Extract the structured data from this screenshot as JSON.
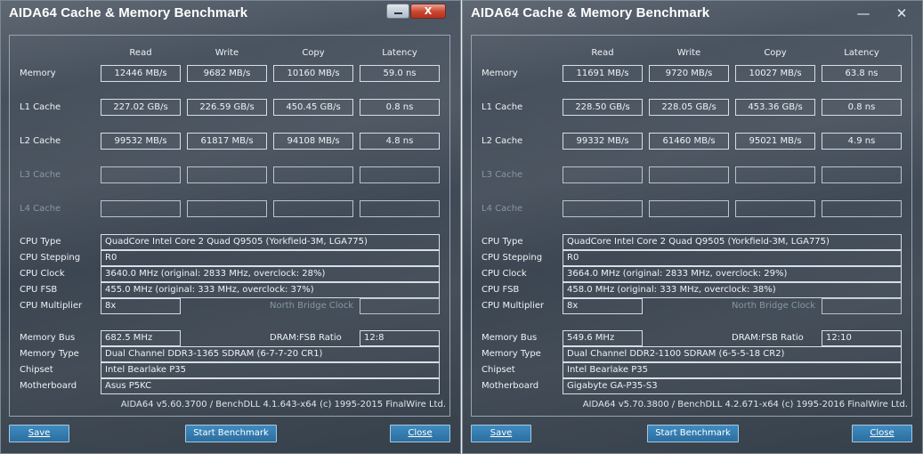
{
  "left": {
    "title": "AIDA64 Cache & Memory Benchmark",
    "close_glyph": "X",
    "headers": [
      "Read",
      "Write",
      "Copy",
      "Latency"
    ],
    "rows": {
      "memory": {
        "label": "Memory",
        "read": "12446 MB/s",
        "write": "9682 MB/s",
        "copy": "10160 MB/s",
        "latency": "59.0 ns"
      },
      "l1": {
        "label": "L1 Cache",
        "read": "227.02 GB/s",
        "write": "226.59 GB/s",
        "copy": "450.45 GB/s",
        "latency": "0.8 ns"
      },
      "l2": {
        "label": "L2 Cache",
        "read": "99532 MB/s",
        "write": "61817 MB/s",
        "copy": "94108 MB/s",
        "latency": "4.8 ns"
      },
      "l3": {
        "label": "L3 Cache"
      },
      "l4": {
        "label": "L4 Cache"
      }
    },
    "cpu_type_label": "CPU Type",
    "cpu_type": "QuadCore Intel Core 2 Quad Q9505  (Yorkfield-3M, LGA775)",
    "cpu_stepping_label": "CPU Stepping",
    "cpu_stepping": "R0",
    "cpu_clock_label": "CPU Clock",
    "cpu_clock": "3640.0 MHz  (original: 2833 MHz, overclock: 28%)",
    "cpu_fsb_label": "CPU FSB",
    "cpu_fsb": "455.0 MHz  (original: 333 MHz, overclock: 37%)",
    "cpu_multiplier_label": "CPU Multiplier",
    "cpu_multiplier": "8x",
    "nb_clock_label": "North Bridge Clock",
    "memory_bus_label": "Memory Bus",
    "memory_bus": "682.5 MHz",
    "dram_ratio_label": "DRAM:FSB Ratio",
    "dram_ratio": "12:8",
    "memory_type_label": "Memory Type",
    "memory_type": "Dual Channel DDR3-1365 SDRAM  (6-7-7-20 CR1)",
    "chipset_label": "Chipset",
    "chipset": "Intel Bearlake P35",
    "motherboard_label": "Motherboard",
    "motherboard": "Asus P5KC",
    "footer": "AIDA64 v5.60.3700 / BenchDLL 4.1.643-x64  (c) 1995-2015 FinalWire Ltd.",
    "buttons": {
      "save": "Save",
      "start": "Start Benchmark",
      "close": "Close"
    }
  },
  "right": {
    "title": "AIDA64 Cache & Memory Benchmark",
    "minimize_glyph": "—",
    "close_glyph": "✕",
    "headers": [
      "Read",
      "Write",
      "Copy",
      "Latency"
    ],
    "rows": {
      "memory": {
        "label": "Memory",
        "read": "11691 MB/s",
        "write": "9720 MB/s",
        "copy": "10027 MB/s",
        "latency": "63.8 ns"
      },
      "l1": {
        "label": "L1 Cache",
        "read": "228.50 GB/s",
        "write": "228.05 GB/s",
        "copy": "453.36 GB/s",
        "latency": "0.8 ns"
      },
      "l2": {
        "label": "L2 Cache",
        "read": "99332 MB/s",
        "write": "61460 MB/s",
        "copy": "95021 MB/s",
        "latency": "4.9 ns"
      },
      "l3": {
        "label": "L3 Cache"
      },
      "l4": {
        "label": "L4 Cache"
      }
    },
    "cpu_type_label": "CPU Type",
    "cpu_type": "QuadCore Intel Core 2 Quad Q9505  (Yorkfield-3M, LGA775)",
    "cpu_stepping_label": "CPU Stepping",
    "cpu_stepping": "R0",
    "cpu_clock_label": "CPU Clock",
    "cpu_clock": "3664.0 MHz  (original: 2833 MHz, overclock: 29%)",
    "cpu_fsb_label": "CPU FSB",
    "cpu_fsb": "458.0 MHz  (original: 333 MHz, overclock: 38%)",
    "cpu_multiplier_label": "CPU Multiplier",
    "cpu_multiplier": "8x",
    "nb_clock_label": "North Bridge Clock",
    "memory_bus_label": "Memory Bus",
    "memory_bus": "549.6 MHz",
    "dram_ratio_label": "DRAM:FSB Ratio",
    "dram_ratio": "12:10",
    "memory_type_label": "Memory Type",
    "memory_type": "Dual Channel DDR2-1100 SDRAM  (6-5-5-18 CR2)",
    "chipset_label": "Chipset",
    "chipset": "Intel Bearlake P35",
    "motherboard_label": "Motherboard",
    "motherboard": "Gigabyte GA-P35-S3",
    "footer": "AIDA64 v5.70.3800 / BenchDLL 4.2.671-x64  (c) 1995-2016 FinalWire Ltd.",
    "buttons": {
      "save": "Save",
      "start": "Start Benchmark",
      "close": "Close"
    }
  }
}
